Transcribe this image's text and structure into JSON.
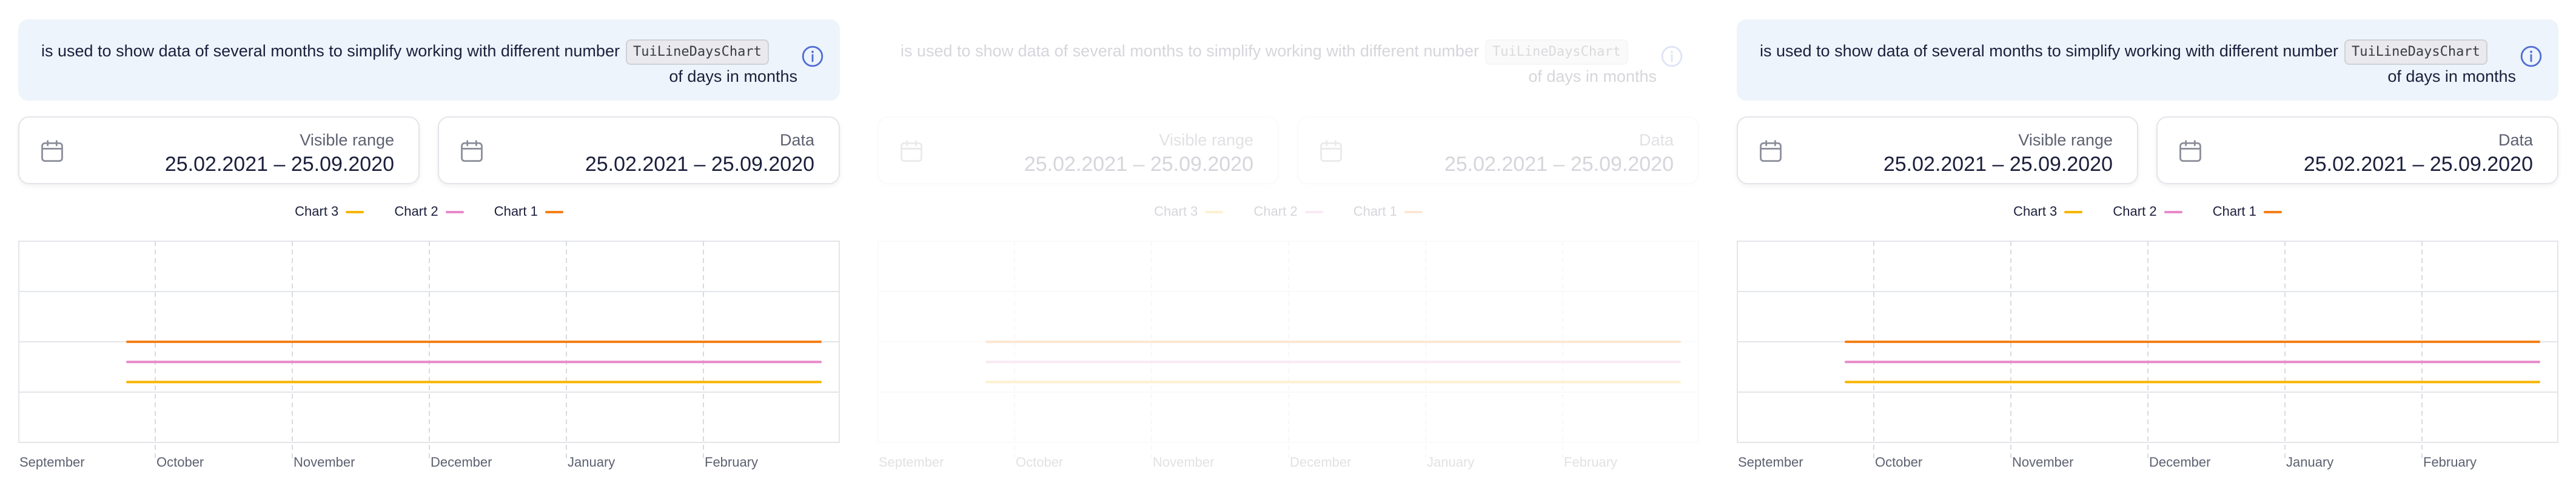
{
  "info": {
    "text_before": "is used to show data of several months to simplify working with different number",
    "code": "TuiLineDaysChart",
    "text_after": "of days in months",
    "icon": "info-icon"
  },
  "visible_range": {
    "label": "Visible range",
    "value": "25.02.2021 – 25.09.2020",
    "icon": "calendar-icon"
  },
  "data_range": {
    "label": "Data",
    "value": "25.02.2021 – 25.09.2020",
    "icon": "calendar-icon"
  },
  "legend": [
    {
      "label": "Chart 3",
      "color": "#f7b500"
    },
    {
      "label": "Chart 2",
      "color": "#e889c9"
    },
    {
      "label": "Chart 1",
      "color": "#f47f17"
    }
  ],
  "chart_data": {
    "type": "line",
    "x": [
      "September",
      "October",
      "November",
      "December",
      "January",
      "February"
    ],
    "series": [
      {
        "name": "Chart 1",
        "color": "#f47f17",
        "level": 0.5
      },
      {
        "name": "Chart 2",
        "color": "#e889c9",
        "level": 0.4
      },
      {
        "name": "Chart 3",
        "color": "#f7b500",
        "level": 0.3
      }
    ],
    "ylim": [
      0,
      1
    ],
    "grid": true
  }
}
